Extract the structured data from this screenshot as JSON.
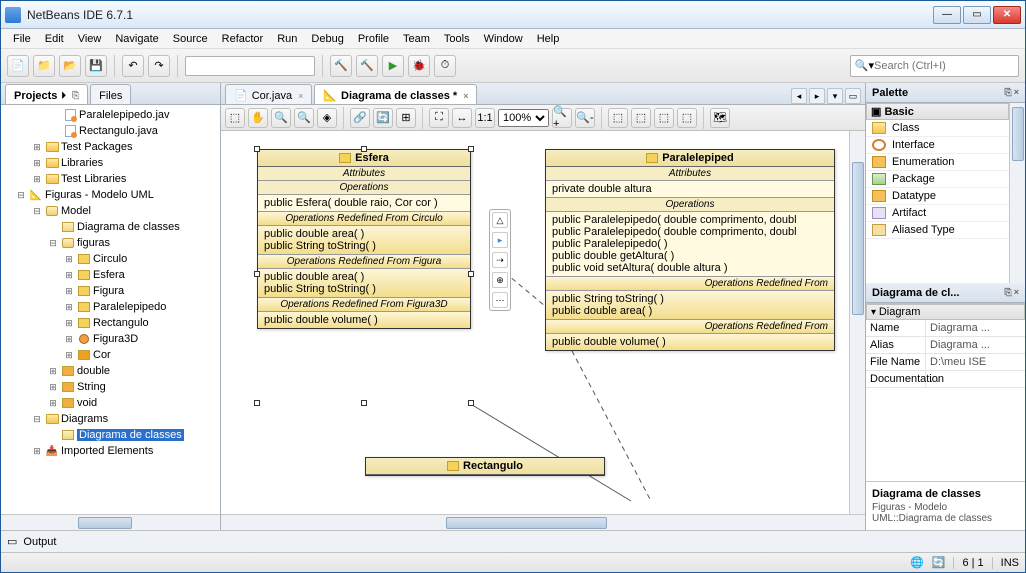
{
  "title": "NetBeans IDE 6.7.1",
  "menu": [
    "File",
    "Edit",
    "View",
    "Navigate",
    "Source",
    "Refactor",
    "Run",
    "Debug",
    "Profile",
    "Team",
    "Tools",
    "Window",
    "Help"
  ],
  "search_placeholder": "Search (Ctrl+I)",
  "left_tabs": {
    "projects": "Projects",
    "files": "Files"
  },
  "tree": {
    "n0": "Paralelepipedo.jav",
    "n1": "Rectangulo.java",
    "n2": "Test Packages",
    "n3": "Libraries",
    "n4": "Test Libraries",
    "n5": "Figuras - Modelo UML",
    "n6": "Model",
    "n7": "Diagrama de classes",
    "n8": "figuras",
    "c_circ": "Circulo",
    "c_esf": "Esfera",
    "c_fig": "Figura",
    "c_par": "Paralelepipedo",
    "c_rec": "Rectangulo",
    "c_f3d": "Figura3D",
    "c_cor": "Cor",
    "d_dbl": "double",
    "d_str": "String",
    "d_void": "void",
    "diagrams": "Diagrams",
    "diag_item": "Diagrama de classes",
    "imported": "Imported Elements"
  },
  "editor_tabs": {
    "cor": "Cor.java",
    "diag": "Diagrama de classes *"
  },
  "zoom": "100%",
  "uml": {
    "esfera": {
      "name": "Esfera",
      "attr_hdr": "Attributes",
      "ops_hdr": "Operations",
      "op1": "public Esfera( double raio, Cor cor )",
      "red_circ": "Operations Redefined From Circulo",
      "rc1": "public double  area( )",
      "rc2": "public String  toString( )",
      "red_fig": "Operations Redefined From Figura",
      "rf1": "public double  area( )",
      "rf2": "public String  toString( )",
      "red_f3d": "Operations Redefined From Figura3D",
      "r3d1": "public double  volume( )"
    },
    "paralel": {
      "name": "Paralelepiped",
      "attr_hdr": "Attributes",
      "attr1": "private double altura",
      "ops_hdr": "Operations",
      "op1": "public Paralelepipedo( double comprimento, doubl",
      "op2": "public Paralelepipedo( double comprimento, doubl",
      "op3": "public Paralelepipedo( )",
      "op4": "public double  getAltura( )",
      "op5": "public void  setAltura( double altura )",
      "red_from": "Operations Redefined From",
      "rr1": "public String  toString( )",
      "rr2": "public double  area( )",
      "red_from2": "Operations Redefined From",
      "rv1": "public double  volume( )"
    },
    "rect": {
      "name": "Rectangulo"
    }
  },
  "palette": {
    "title": "Palette",
    "group": "Basic",
    "items": {
      "cls": "Class",
      "int": "Interface",
      "enum": "Enumeration",
      "pkg": "Package",
      "dt": "Datatype",
      "art": "Artifact",
      "al": "Aliased Type"
    }
  },
  "props": {
    "title": "Diagrama de cl...",
    "group": "Diagram",
    "rows": {
      "name_k": "Name",
      "name_v": "Diagrama ...",
      "alias_k": "Alias",
      "alias_v": "Diagrama ...",
      "fn_k": "File Name",
      "fn_v": "D:\\meu ISE",
      "doc_k": "Documentation",
      "doc_v": "..."
    },
    "footer_title": "Diagrama de classes",
    "footer_line": "Figuras - Modelo UML::Diagrama de classes"
  },
  "output_label": "Output",
  "status": {
    "pos": "6 | 1",
    "ins": "INS"
  }
}
